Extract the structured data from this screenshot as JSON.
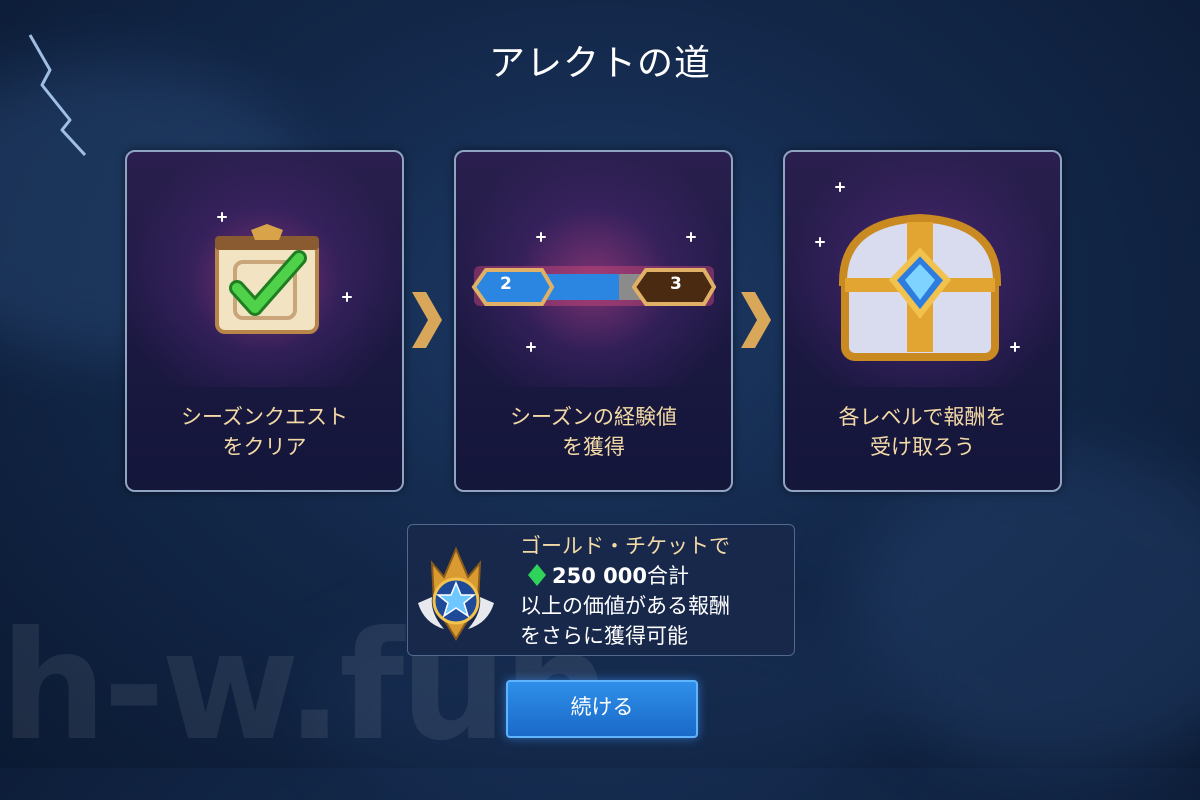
{
  "title": "アレクトの道",
  "steps": [
    {
      "line1": "シーズンクエスト",
      "line2": "をクリア",
      "icon": "clipboard-check-icon"
    },
    {
      "line1": "シーズンの経験値",
      "line2": "を獲得",
      "icon": "level-progress-bar",
      "level_from": "2",
      "level_to": "3"
    },
    {
      "line1": "各レベルで報酬を",
      "line2": "受け取ろう",
      "icon": "treasure-chest-icon"
    }
  ],
  "ticket": {
    "line1": "ゴールド・チケットで",
    "amount": "250 000",
    "amount_suffix": "合計",
    "line3": "以上の価値がある報酬",
    "line4": "をさらに獲得可能",
    "icon": "star-badge-icon",
    "currency_icon": "green-gem-icon"
  },
  "continue_label": "続ける",
  "watermark": "h-w.fun",
  "colors": {
    "caption": "#f3d9a6",
    "button": "#1f7ad8",
    "arrow": "#d9a75a",
    "gem": "#2fd35a"
  }
}
